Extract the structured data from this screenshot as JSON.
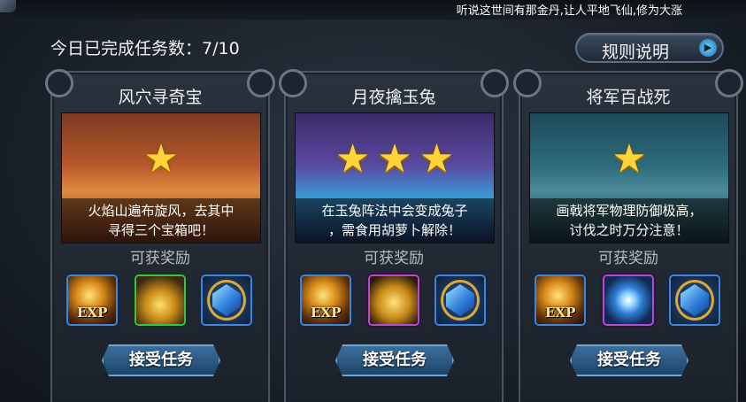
{
  "header": {
    "ticker": "听说这世间有那金丹,让人平地飞仙,修为大涨",
    "progress_label": "今日已完成任务数：7/10",
    "rules_button": "规则说明"
  },
  "cards": [
    {
      "title": "风穴寻奇宝",
      "stars": 1,
      "description_line1": "火焰山遍布旋风，去其中",
      "description_line2": "寻得三个宝箱吧！",
      "reward_label": "可获奖励",
      "rewards": [
        {
          "type": "exp",
          "icon": "exp-icon",
          "text": "EXP",
          "border": "blue"
        },
        {
          "type": "gold",
          "icon": "gold-coins-icon",
          "border": "green"
        },
        {
          "type": "gem",
          "icon": "blue-gem-icon",
          "border": "blue"
        }
      ],
      "accept_label": "接受任务"
    },
    {
      "title": "月夜擒玉兔",
      "stars": 3,
      "description_line1": "在玉兔阵法中会变成兔子",
      "description_line2": "，需食用胡萝卜解除！",
      "reward_label": "可获奖励",
      "rewards": [
        {
          "type": "exp",
          "icon": "exp-icon",
          "text": "EXP",
          "border": "blue"
        },
        {
          "type": "bag",
          "icon": "gold-bag-icon",
          "border": "purple"
        },
        {
          "type": "gem",
          "icon": "blue-gem-icon",
          "border": "blue"
        }
      ],
      "accept_label": "接受任务"
    },
    {
      "title": "将军百战死",
      "stars": 1,
      "description_line1": "画戟将军物理防御极高，",
      "description_line2": "讨伐之时万分注意！",
      "reward_label": "可获奖励",
      "rewards": [
        {
          "type": "exp",
          "icon": "exp-icon",
          "text": "EXP",
          "border": "blue"
        },
        {
          "type": "orb",
          "icon": "spirit-orb-icon",
          "border": "purple"
        },
        {
          "type": "gem",
          "icon": "blue-gem-icon",
          "border": "blue"
        }
      ],
      "accept_label": "接受任务"
    }
  ],
  "colors": {
    "star": "#ffd43a",
    "accept_button": "#2e5c86",
    "blue_frame": "#3f86d8",
    "green_frame": "#3fbf4a",
    "purple_frame": "#b44bd6"
  }
}
